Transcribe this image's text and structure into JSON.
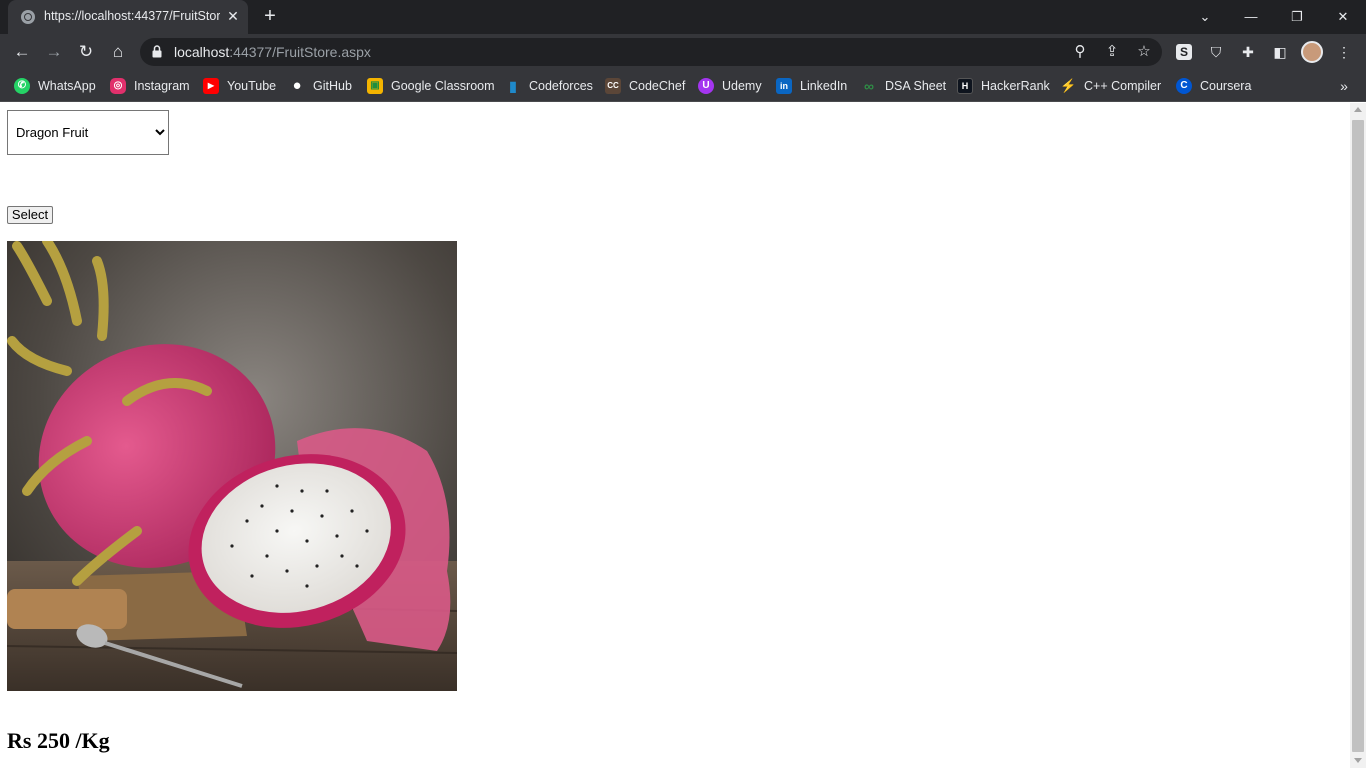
{
  "browser": {
    "tab_title": "https://localhost:44377/FruitStore.aspx",
    "url_host": "localhost",
    "url_rest": ":44377/FruitStore.aspx",
    "close_glyph": "✕",
    "new_tab_glyph": "+",
    "back_glyph": "←",
    "forward_glyph": "→",
    "reload_glyph": "↻",
    "home_glyph": "⌂",
    "tab_search_glyph": "⌄",
    "minimize_glyph": "—",
    "restore_glyph": "❐",
    "window_close_glyph": "✕",
    "zoom_glyph": "⚲",
    "share_glyph": "⇪",
    "star_glyph": "☆",
    "ext_s_label": "S",
    "ext_shield_glyph": "⛉",
    "ext_puzzle_glyph": "✚",
    "sidepanel_glyph": "◧",
    "menu_glyph": "⋮",
    "more_glyph": "»"
  },
  "bookmarks": [
    {
      "label": "WhatsApp",
      "icon": "whatsapp-icon",
      "color": "#25d366",
      "glyph": "✆"
    },
    {
      "label": "Instagram",
      "icon": "instagram-icon",
      "color": "#e1306c",
      "glyph": "◎"
    },
    {
      "label": "YouTube",
      "icon": "youtube-icon",
      "color": "#ff0000",
      "glyph": "▶"
    },
    {
      "label": "GitHub",
      "icon": "github-icon",
      "color": "#ffffff",
      "glyph": "●"
    },
    {
      "label": "Google Classroom",
      "icon": "google-classroom-icon",
      "color": "#f4b400",
      "glyph": "▣"
    },
    {
      "label": "Codeforces",
      "icon": "codeforces-icon",
      "color": "#1f8acb",
      "glyph": "▮"
    },
    {
      "label": "CodeChef",
      "icon": "codechef-icon",
      "color": "#5b4638",
      "glyph": "CC"
    },
    {
      "label": "Udemy",
      "icon": "udemy-icon",
      "color": "#a435f0",
      "glyph": "U"
    },
    {
      "label": "LinkedIn",
      "icon": "linkedin-icon",
      "color": "#0a66c2",
      "glyph": "in"
    },
    {
      "label": "DSA Sheet",
      "icon": "dsa-sheet-icon",
      "color": "#2f8d46",
      "glyph": "∞"
    },
    {
      "label": "HackerRank",
      "icon": "hackerrank-icon",
      "color": "#0e141e",
      "glyph": "H"
    },
    {
      "label": "C++ Compiler",
      "icon": "cpp-compiler-icon",
      "color": "#6c63ff",
      "glyph": "⚡"
    },
    {
      "label": "Coursera",
      "icon": "coursera-icon",
      "color": "#0056d2",
      "glyph": "C"
    }
  ],
  "page": {
    "fruit_options": [
      "Dragon Fruit"
    ],
    "selected_fruit": "Dragon Fruit",
    "select_button_label": "Select",
    "price_text": "Rs 250 /Kg"
  }
}
